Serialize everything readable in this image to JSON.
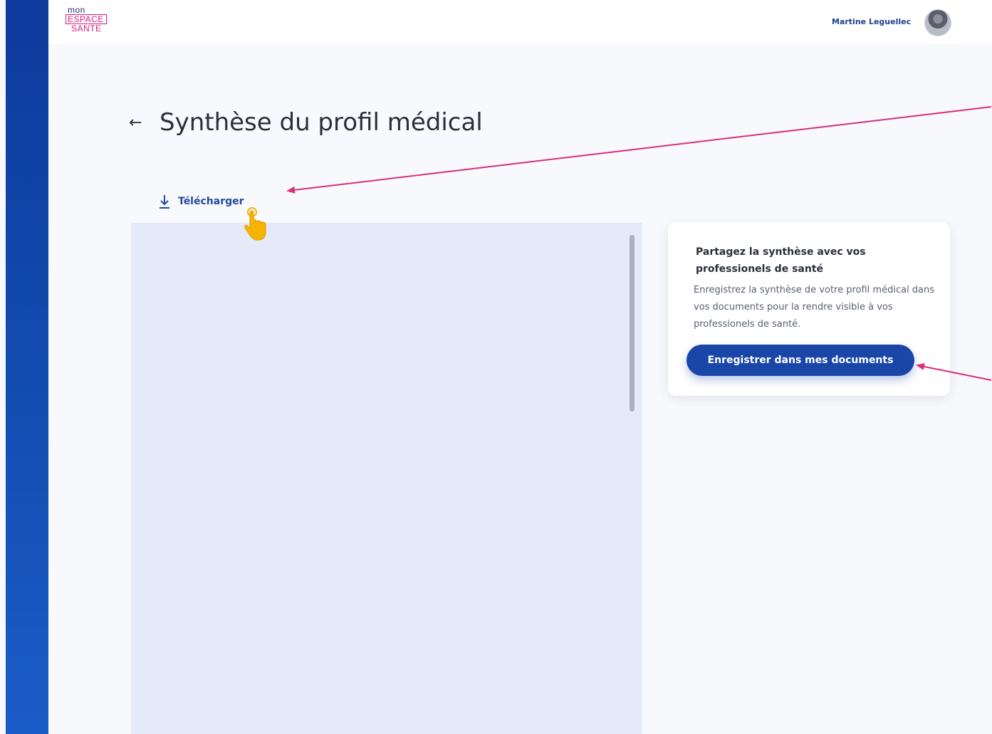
{
  "header": {
    "logo": {
      "line1": "mon",
      "line2": "ESPACE",
      "line3": "SANTE"
    },
    "user_name": "Martine Leguellec",
    "avatar_icon": "user-avatar"
  },
  "page": {
    "back_icon": "arrow-left-icon",
    "title": "Synthèse du profil médical",
    "download_label": "Télécharger",
    "download_icon": "download-icon"
  },
  "share_card": {
    "title": "Partagez la synthèse avec vos professionels de santé",
    "description": "Enregistrez la synthèse de votre profil médical dans vos documents pour la rendre visible à vos professionels de santé.",
    "button_label": "Enregistrer dans mes documents"
  },
  "colors": {
    "sidebar": "#1248ad",
    "primary": "#1a46a8",
    "annotation_arrow": "#d62f7a",
    "cursor": "#f5b400",
    "preview_bg": "#e4eaf7"
  }
}
